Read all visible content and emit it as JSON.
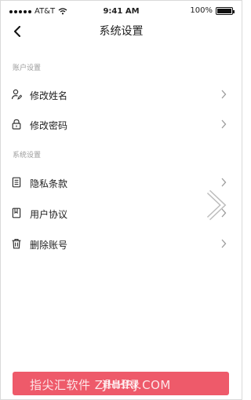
{
  "status_bar": {
    "carrier": "AT&T",
    "time": "9:41 AM",
    "battery_label": "100%",
    "battery_level": 1.0
  },
  "nav": {
    "title": "系统设置"
  },
  "account_section": {
    "title": "账户设置",
    "items": [
      {
        "label": "修改姓名",
        "icon": "user-edit-icon"
      },
      {
        "label": "修改密码",
        "icon": "lock-icon"
      }
    ]
  },
  "system_section": {
    "title": "系统设置",
    "items": [
      {
        "label": "隐私条款",
        "icon": "document-icon"
      },
      {
        "label": "用户协议",
        "icon": "bookmark-icon"
      },
      {
        "label": "删除账号",
        "icon": "trash-icon"
      }
    ]
  },
  "logout_button": {
    "label": "退出登录"
  },
  "watermark": {
    "text": "指尖汇软件 ZJHHRJ.COM"
  },
  "colors": {
    "accent": "#ee5a6a",
    "section_title": "#9b9b9b"
  }
}
